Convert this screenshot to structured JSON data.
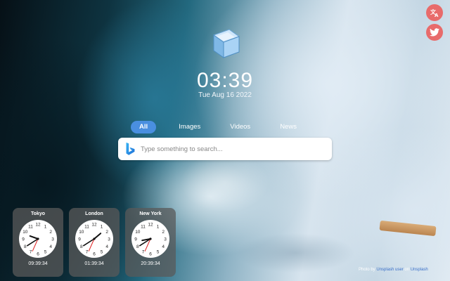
{
  "clock": {
    "time": "03:39",
    "date": "Tue Aug 16 2022"
  },
  "tabs": [
    {
      "label": "All",
      "active": true
    },
    {
      "label": "Images",
      "active": false
    },
    {
      "label": "Videos",
      "active": false
    },
    {
      "label": "News",
      "active": false
    }
  ],
  "search": {
    "placeholder": "Type something to search..."
  },
  "world_clocks": [
    {
      "city": "Tokyo",
      "digital": "09:39:34",
      "hour": 9,
      "minute": 39,
      "second": 34
    },
    {
      "city": "London",
      "digital": "01:39:34",
      "hour": 1,
      "minute": 39,
      "second": 34
    },
    {
      "city": "New York",
      "digital": "20:39:34",
      "hour": 20,
      "minute": 39,
      "second": 34
    }
  ],
  "credit": {
    "prefix": "Photo by",
    "author": "Unsplash user",
    "middle": "on",
    "site": "Unsplash"
  },
  "colors": {
    "accent": "#4a8fe0",
    "social": "#e86b6b",
    "card": "#5a5a5a"
  },
  "icons": {
    "translate": "translate-icon",
    "twitter": "twitter-icon",
    "logo": "ice-cube-logo",
    "bing": "bing-icon"
  }
}
